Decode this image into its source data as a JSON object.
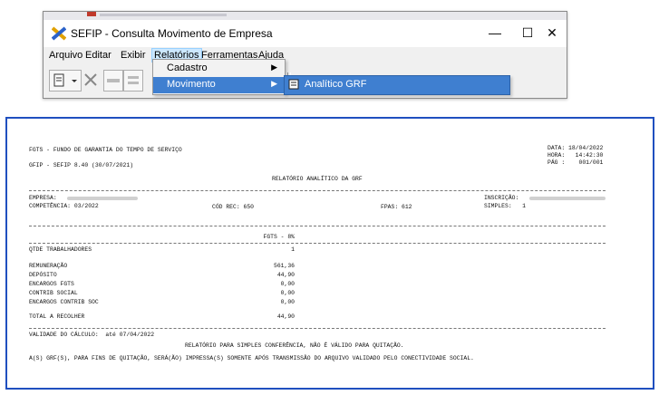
{
  "window": {
    "title": "SEFIP - Consulta Movimento de Empresa",
    "minimize": "—",
    "maximize": "☐",
    "close": "✕"
  },
  "menubar": [
    "Arquivo",
    "Editar",
    "Exibir",
    "Relatórios",
    "Ferramentas",
    "Ajuda"
  ],
  "relatorios_menu": {
    "items": [
      "Cadastro",
      "Movimento"
    ],
    "submenu": "Analítico GRF"
  },
  "colors": {
    "highlight": "#3f7fd0",
    "report_border": "#1f4fbf"
  },
  "report": {
    "org": "FGTS - FUNDO DE GARANTIA DO TEMPO DE SERVIÇO",
    "version": "GFIP - SEFIP 8.40 (30/07/2021)",
    "data": "DATA: 18/04/2022",
    "hora": "HORA:   14:42:30",
    "pag": "PÁG :    001/001",
    "title": "RELATÓRIO ANALÍTICO DA GRF",
    "empresa_label": "EMPRESA:",
    "inscricao_label": "INSCRIÇÃO:",
    "competencia": "COMPETÊNCIA: 03/2022",
    "cod_rec": "CÓD REC: 650",
    "fpas": "FPAS: 612",
    "simples": "SIMPLES:   1",
    "fgts_header": "FGTS - 8%",
    "rows": [
      {
        "label": "QTDE TRABALHADORES",
        "value": "1"
      },
      {
        "label": "REMUNERAÇÃO",
        "value": "561,36"
      },
      {
        "label": "DEPÓSITO",
        "value": "44,90"
      },
      {
        "label": "ENCARGOS FGTS",
        "value": "0,00"
      },
      {
        "label": "CONTRIB SOCIAL",
        "value": "0,00"
      },
      {
        "label": "ENCARGOS CONTRIB SOC",
        "value": "0,00"
      },
      {
        "label": "TOTAL A RECOLHER",
        "value": "44,90"
      }
    ],
    "validade": "VALIDADE DO CÁLCULO:  até 07/04/2022",
    "aviso1": "RELATÓRIO PARA SIMPLES CONFERÊNCIA, NÃO É VÁLIDO PARA QUITAÇÃO.",
    "aviso2": "A(S) GRF(S), PARA FINS DE QUITAÇÃO, SERÁ(ÃO) IMPRESSA(S) SOMENTE APÓS TRANSMISSÃO DO ARQUIVO VALIDADO PELO CONECTIVIDADE SOCIAL."
  }
}
